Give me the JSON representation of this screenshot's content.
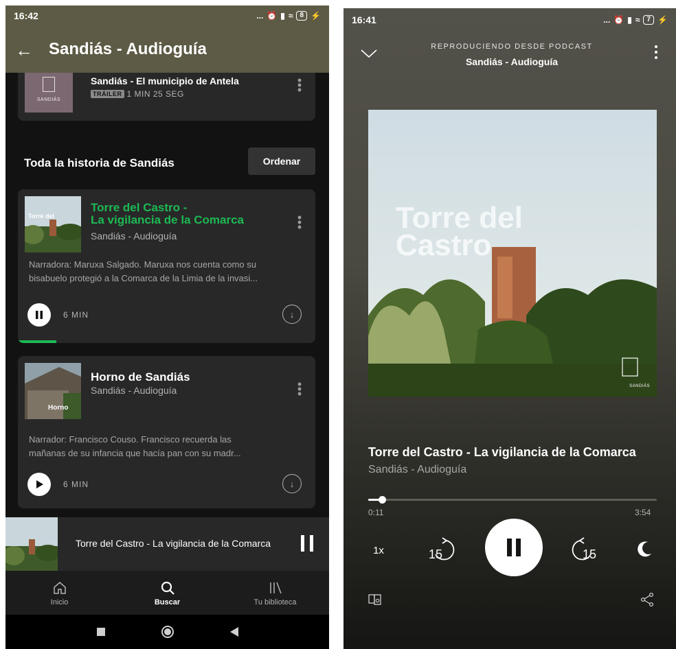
{
  "left": {
    "status": {
      "time": "16:42",
      "dots": "...",
      "battery": "8"
    },
    "header": {
      "back_icon": "arrow-left-icon",
      "title": "Sandiás - Audioguía"
    },
    "trailer": {
      "thumb_label": "SANDIÁS",
      "title": "Sandiás - El municipio de Antela",
      "badge": "TRÁILER",
      "duration": "1 MIN 25 SEG"
    },
    "section": {
      "title": "Toda la historia de Sandiás",
      "sort_label": "Ordenar"
    },
    "episodes": [
      {
        "title_line1": "Torre del Castro -",
        "title_line2": "La vigilancia de la Comarca",
        "author": "Sandiás - Audioguía",
        "description_line1": "Narradora: Maruxa Salgado.  Maruxa nos cuenta como su",
        "description_line2": "bisabuelo protegió a la Comarca de la Limia de la invasi...",
        "duration": "6 MIN",
        "state": "playing",
        "progress": 0.13,
        "title_color": "#1db954"
      },
      {
        "title_line1": "Horno de Sandiás",
        "thumb_label": "Horno",
        "author": "Sandiás - Audioguía",
        "description_line1": "Narrador: Francisco Couso.  Francisco recuerda las",
        "description_line2": "mañanas de su infancia que hacía pan con su madr...",
        "duration": "6 MIN",
        "state": "paused"
      }
    ],
    "mini_player": {
      "title": "Torre del Castro - La vigilancia de la Comarca"
    },
    "nav": [
      {
        "label": "Inicio",
        "icon": "home-icon"
      },
      {
        "label": "Buscar",
        "icon": "search-icon",
        "active": true
      },
      {
        "label": "Tu biblioteca",
        "icon": "library-icon"
      }
    ]
  },
  "right": {
    "status": {
      "time": "16:41",
      "dots": "...",
      "battery": "7"
    },
    "playing_from_label": "REPRODUCIENDO DESDE PODCAST",
    "playing_from_name": "Sandiás - Audioguía",
    "cover": {
      "line1": "Torre del",
      "line2": "Castro",
      "logo_label": "SANDIÁS"
    },
    "track": {
      "title": "Torre del Castro - La vigilancia de la Comarca",
      "author": "Sandiás - Audioguía",
      "elapsed": "0:11",
      "total": "3:54",
      "progress": 0.047
    },
    "controls": {
      "speed": "1x",
      "skip_back": "15",
      "skip_forward": "15"
    },
    "accent": "#1db954"
  }
}
